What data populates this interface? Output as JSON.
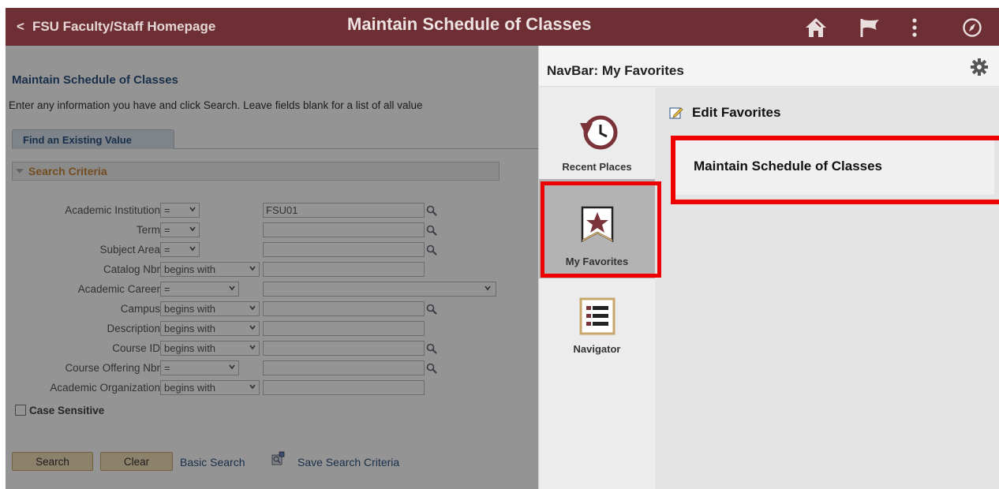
{
  "header": {
    "back_label": "FSU Faculty/Staff Homepage",
    "back_chevron": "<",
    "page_title": "Maintain Schedule of Classes",
    "icons": [
      "home-icon",
      "flag-icon",
      "kebab-menu-icon",
      "compass-icon"
    ],
    "bg_color": "#6e2f34"
  },
  "main": {
    "title": "Maintain Schedule of Classes",
    "instructions": "Enter any information you have and click Search. Leave fields blank for a list of all value",
    "tab_label": "Find an Existing Value",
    "section_label": "Search Criteria",
    "fields": [
      {
        "label": "Academic Institution",
        "operator": "=",
        "value": "FSU01"
      },
      {
        "label": "Term",
        "operator": "=",
        "value": ""
      },
      {
        "label": "Subject Area",
        "operator": "=",
        "value": ""
      },
      {
        "label": "Catalog Nbr",
        "operator": "begins with",
        "value": ""
      },
      {
        "label": "Academic Career",
        "operator": "=",
        "value": ""
      },
      {
        "label": "Campus",
        "operator": "begins with",
        "value": ""
      },
      {
        "label": "Description",
        "operator": "begins with",
        "value": ""
      },
      {
        "label": "Course ID",
        "operator": "begins with",
        "value": ""
      },
      {
        "label": "Course Offering Nbr",
        "operator": "=",
        "value": ""
      },
      {
        "label": "Academic Organization",
        "operator": "begins with",
        "value": ""
      }
    ],
    "case_sensitive_label": "Case Sensitive",
    "search_button": "Search",
    "clear_button": "Clear",
    "basic_search_link": "Basic Search",
    "save_criteria_link": "Save Search Criteria"
  },
  "navbar": {
    "title": "NavBar: My Favorites",
    "tiles": [
      {
        "label": "Recent Places",
        "icon": "recent-places-icon"
      },
      {
        "label": "My Favorites",
        "icon": "favorites-star-icon",
        "selected": true
      },
      {
        "label": "Navigator",
        "icon": "navigator-list-icon"
      }
    ],
    "edit_favorites_label": "Edit Favorites",
    "favorites": [
      "Maintain Schedule of Classes"
    ],
    "accent_color": "#7a3338",
    "highlight_color": "#ee0000"
  }
}
